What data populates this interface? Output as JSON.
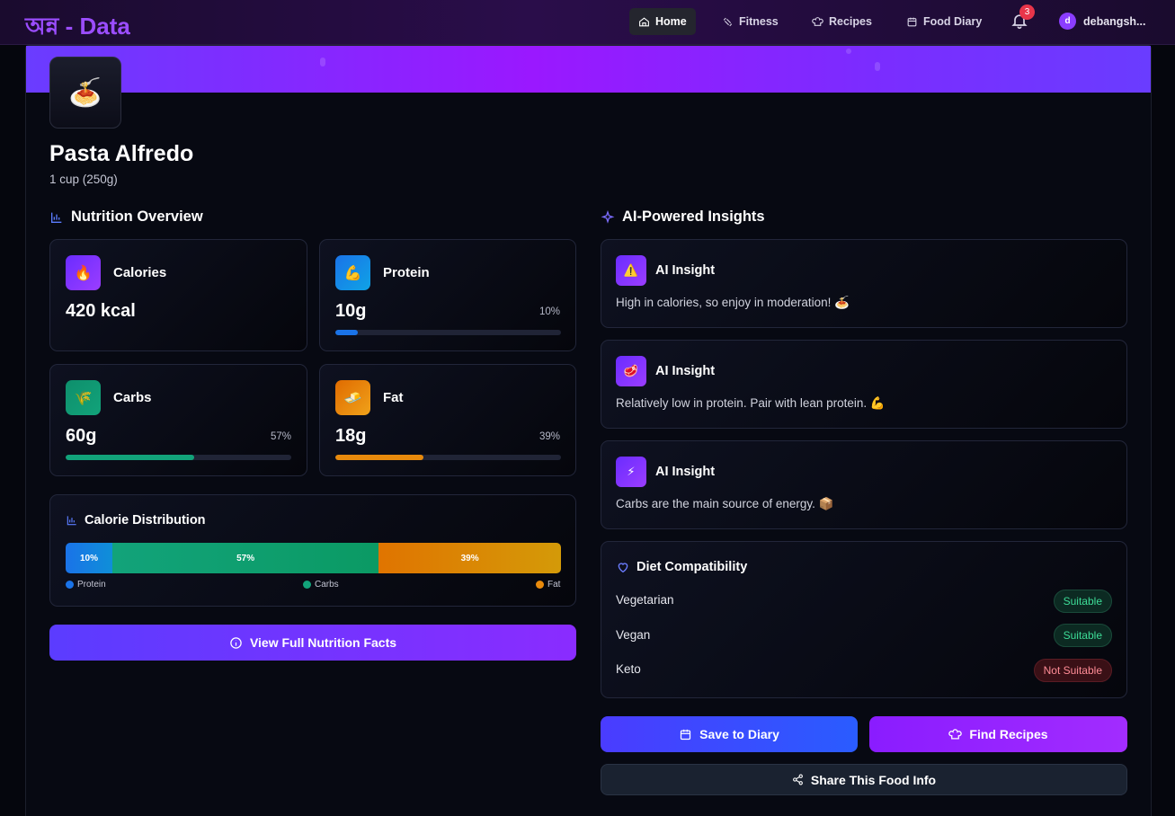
{
  "app": {
    "brand": "অন্ন - Data"
  },
  "nav": {
    "items": [
      {
        "label": "Home",
        "icon": "home-icon",
        "active": true
      },
      {
        "label": "Fitness",
        "icon": "fitness-icon"
      },
      {
        "label": "Recipes",
        "icon": "chef-hat-icon"
      },
      {
        "label": "Food Diary",
        "icon": "calendar-icon"
      }
    ],
    "notification_count": "3",
    "user": {
      "initial": "d",
      "name": "debangsh..."
    }
  },
  "food": {
    "emoji": "🍝",
    "name": "Pasta Alfredo",
    "serving": "1 cup (250g)"
  },
  "nutrition": {
    "title": "Nutrition Overview",
    "calories": {
      "label": "Calories",
      "value": "420 kcal",
      "emoji": "🔥"
    },
    "protein": {
      "label": "Protein",
      "value": "10g",
      "pct": "10%",
      "fill": 0.1,
      "emoji": "💪",
      "color": "#1a73e8"
    },
    "carbs": {
      "label": "Carbs",
      "value": "60g",
      "pct": "57%",
      "fill": 0.57,
      "emoji": "🌾",
      "color": "#12a37a"
    },
    "fat": {
      "label": "Fat",
      "value": "18g",
      "pct": "39%",
      "fill": 0.39,
      "emoji": "🧈",
      "color": "#e88a0c"
    }
  },
  "distribution": {
    "title": "Calorie Distribution",
    "segments": [
      {
        "label": "10%",
        "value": 10
      },
      {
        "label": "57%",
        "value": 57
      },
      {
        "label": "39%",
        "value": 39
      }
    ],
    "legend": [
      "Protein",
      "Carbs",
      "Fat"
    ]
  },
  "buttons": {
    "view_facts": "View Full Nutrition Facts",
    "save_diary": "Save to Diary",
    "find_recipes": "Find Recipes",
    "share": "Share This Food Info"
  },
  "insights": {
    "title": "AI-Powered Insights",
    "items": [
      {
        "title": "AI Insight",
        "emoji": "⚠️",
        "text": "High in calories, so enjoy in moderation! 🍝"
      },
      {
        "title": "AI Insight",
        "emoji": "🥩",
        "text": "Relatively low in protein. Pair with lean protein. 💪"
      },
      {
        "title": "AI Insight",
        "emoji": "⚡",
        "text": "Carbs are the main source of energy. 📦"
      }
    ]
  },
  "diet": {
    "title": "Diet Compatibility",
    "rows": [
      {
        "name": "Vegetarian",
        "status": "Suitable"
      },
      {
        "name": "Vegan",
        "status": "Suitable"
      },
      {
        "name": "Keto",
        "status": "Not Suitable"
      }
    ]
  }
}
